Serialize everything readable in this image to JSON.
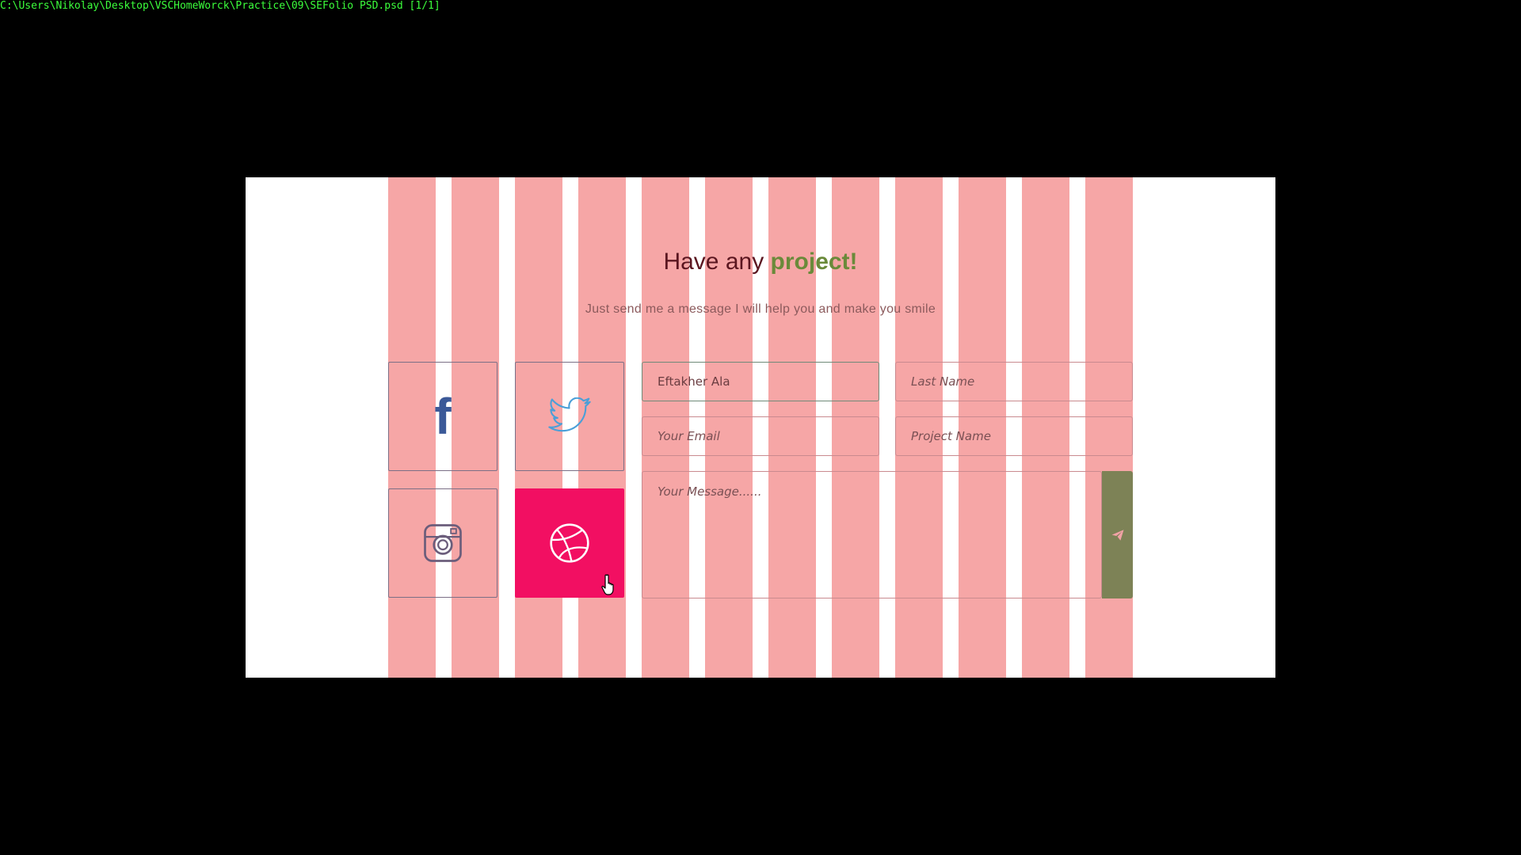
{
  "window": {
    "title": "C:\\Users\\Nikolay\\Desktop\\VSCHomeWorck\\Practice\\09\\SEFolio PSD.psd [1/1]"
  },
  "contact": {
    "heading_prefix": "Have any ",
    "heading_accent": "project!",
    "subheading": "Just send me a message I will help you and make you smile"
  },
  "social": {
    "items": [
      {
        "name": "facebook",
        "icon": "facebook-icon",
        "state": "default"
      },
      {
        "name": "twitter",
        "icon": "twitter-icon",
        "state": "default"
      },
      {
        "name": "instagram",
        "icon": "instagram-icon",
        "state": "default"
      },
      {
        "name": "dribbble",
        "icon": "dribbble-icon",
        "state": "hover"
      }
    ]
  },
  "form": {
    "first_name": {
      "value": "Eftakher Ala",
      "placeholder": ""
    },
    "last_name": {
      "value": "",
      "placeholder": "Last Name"
    },
    "email": {
      "value": "",
      "placeholder": "Your Email"
    },
    "project_name": {
      "value": "",
      "placeholder": "Project Name"
    },
    "message": {
      "value": "",
      "placeholder": "Your Message......"
    },
    "send_icon": "paper-plane-icon"
  },
  "colors": {
    "background": "#000000",
    "canvas": "#ffffff",
    "grid_overlay": "#f6a6a6",
    "heading": "#5b1620",
    "accent": "#6a8a3a",
    "dribbble": "#f20f62",
    "send_button": "#7d8256",
    "facebook": "#3b5998",
    "twitter": "#4a9fd8",
    "title_text": "#3cff3c"
  }
}
